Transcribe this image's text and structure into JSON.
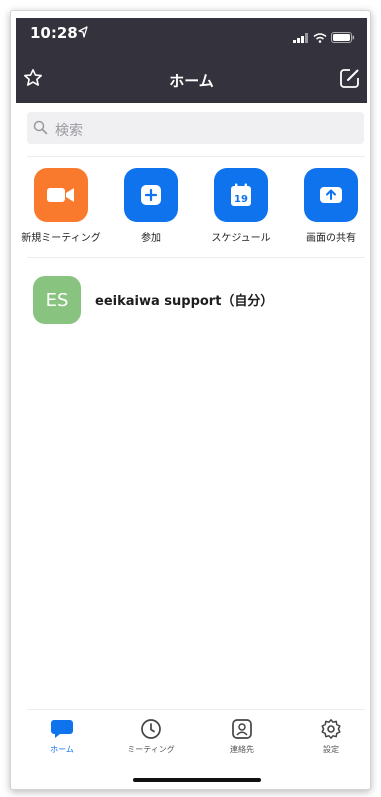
{
  "status_bar": {
    "time": "10:28"
  },
  "nav": {
    "title": "ホーム"
  },
  "search": {
    "placeholder": "検索"
  },
  "actions": [
    {
      "label": "新規ミーティング",
      "icon": "video-camera-icon",
      "color": "#FA7A2D"
    },
    {
      "label": "参加",
      "icon": "plus-icon",
      "color": "#0F73EE"
    },
    {
      "label": "スケジュール",
      "icon": "calendar-icon",
      "color": "#0F73EE",
      "icon_text": "19"
    },
    {
      "label": "画面の共有",
      "icon": "share-screen-icon",
      "color": "#0F73EE"
    }
  ],
  "contacts": [
    {
      "initials": "ES",
      "name": "eeikaiwa support（自分）",
      "avatar_color": "#88C47F"
    }
  ],
  "tabs": [
    {
      "label": "ホーム",
      "icon": "chat-bubble-icon",
      "active": true
    },
    {
      "label": "ミーティング",
      "icon": "clock-icon",
      "active": false
    },
    {
      "label": "連絡先",
      "icon": "contact-icon",
      "active": false
    },
    {
      "label": "設定",
      "icon": "gear-icon",
      "active": false
    }
  ],
  "colors": {
    "header_bg": "#34323D",
    "accent": "#0F73EE"
  }
}
